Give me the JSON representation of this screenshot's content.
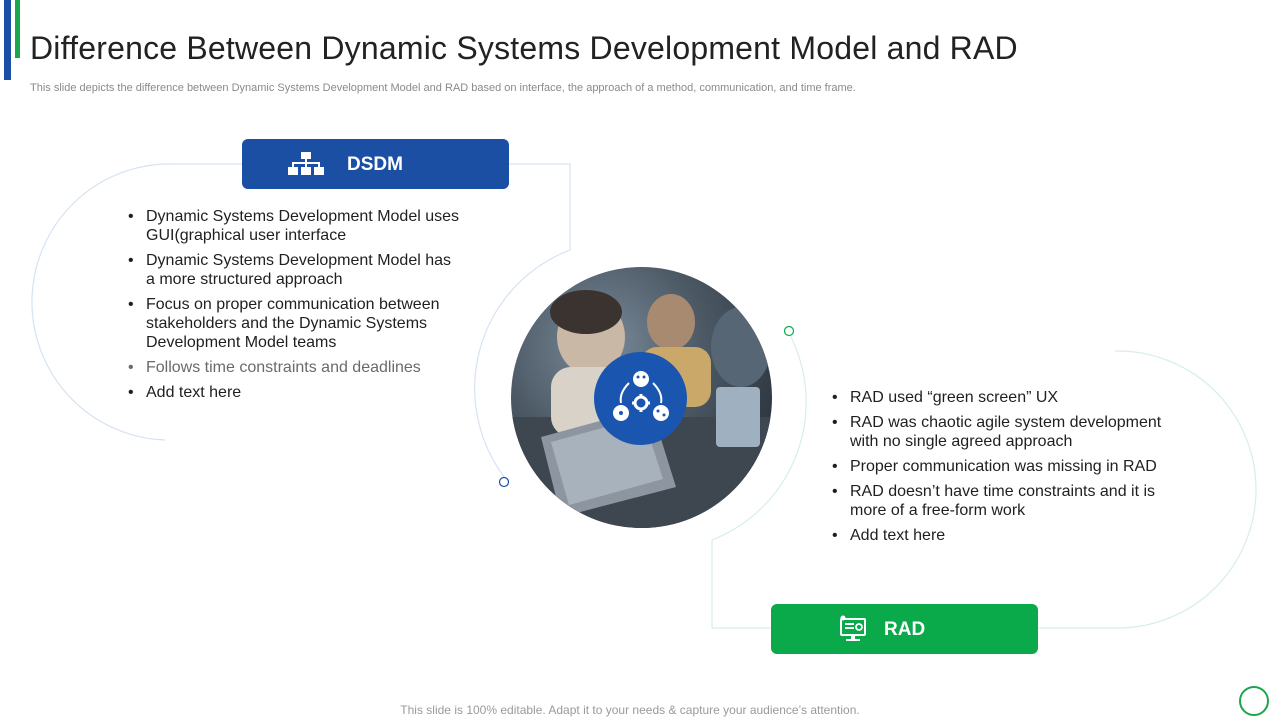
{
  "header": {
    "title": "Difference Between Dynamic Systems Development Model and RAD",
    "subtitle": "This slide depicts the difference between Dynamic Systems Development Model and RAD based on interface, the approach of a method, communication, and time frame."
  },
  "colors": {
    "primary_blue": "#1a4fa3",
    "primary_green": "#0aaa4b",
    "accent_green": "#1ca64c"
  },
  "dsdm": {
    "label": "DSDM",
    "icon": "org-chart-icon",
    "points": [
      "Dynamic Systems Development Model uses GUI(graphical user interface",
      "Dynamic Systems Development Model has a more structured approach",
      "Focus on proper communication between stakeholders and the Dynamic Systems Development Model teams",
      "Follows time constraints and deadlines",
      "Add text here"
    ]
  },
  "rad": {
    "label": "RAD",
    "icon": "computer-settings-icon",
    "points": [
      "RAD used “green screen” UX",
      "RAD was chaotic agile system development with no single agreed approach",
      "Proper communication was missing in RAD",
      "RAD doesn’t have time constraints and it is more of a free-form work",
      "Add text here"
    ]
  },
  "center": {
    "icon": "workflow-gear-icon"
  },
  "footer": {
    "text": "This slide is 100% editable. Adapt it to your needs & capture your audience’s attention."
  }
}
